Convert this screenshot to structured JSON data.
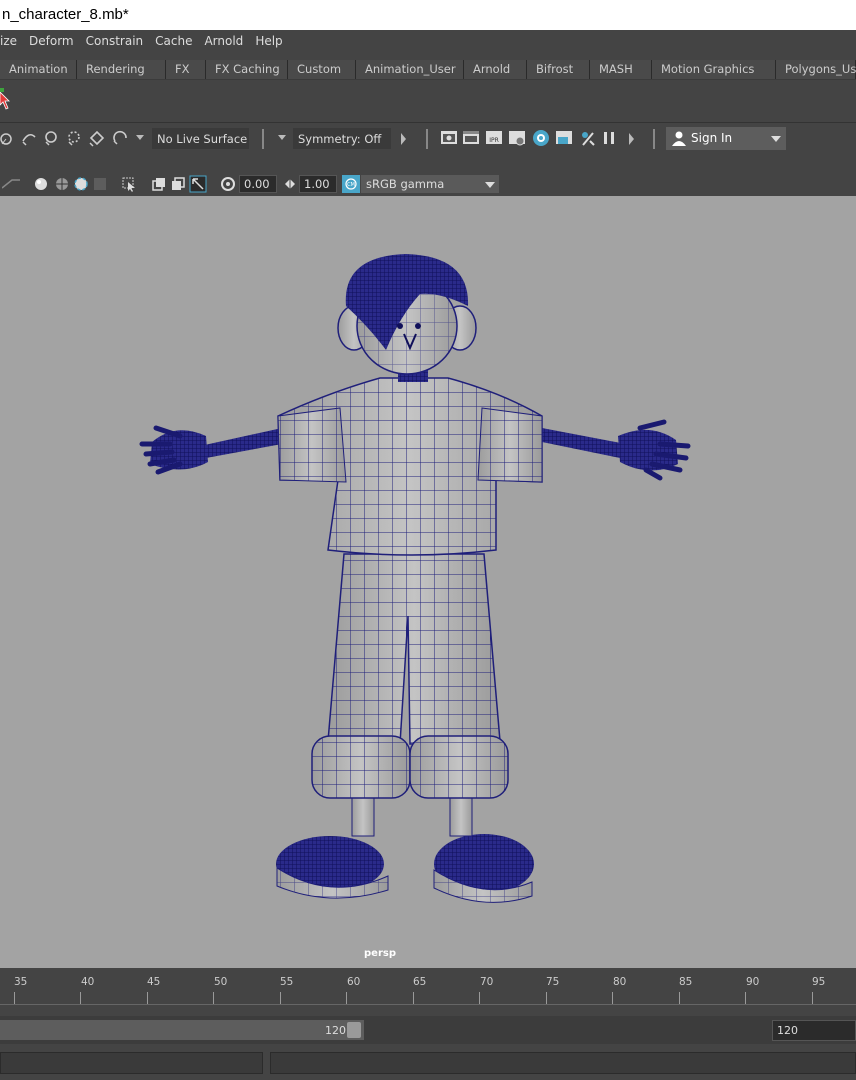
{
  "window": {
    "title": "n_character_8.mb*"
  },
  "menu": [
    "ize",
    "Deform",
    "Constrain",
    "Cache",
    "Arnold",
    "Help"
  ],
  "shelf_tabs": [
    "Animation",
    "Rendering",
    "FX",
    "FX Caching",
    "Custom",
    "Animation_User",
    "Arnold",
    "Bifrost",
    "MASH",
    "Motion Graphics",
    "Polygons_Us"
  ],
  "status_line": {
    "live_surface": "No Live Surface",
    "symmetry": "Symmetry: Off",
    "sign_in": "Sign In"
  },
  "panel_toolbar": {
    "exposure": "0.00",
    "gamma": "1.00",
    "color_space": "sRGB gamma"
  },
  "viewport": {
    "camera_label": "persp"
  },
  "time_slider": {
    "ticks": [
      "35",
      "40",
      "45",
      "50",
      "55",
      "60",
      "65",
      "70",
      "75",
      "80",
      "85",
      "90",
      "95"
    ]
  },
  "range_slider": {
    "end_value": "120",
    "end_field": "120"
  },
  "colors": {
    "wireframe": "#1f1f7a",
    "viewport_bg": "#a3a3a3",
    "accent_blue": "#49a6c9"
  }
}
